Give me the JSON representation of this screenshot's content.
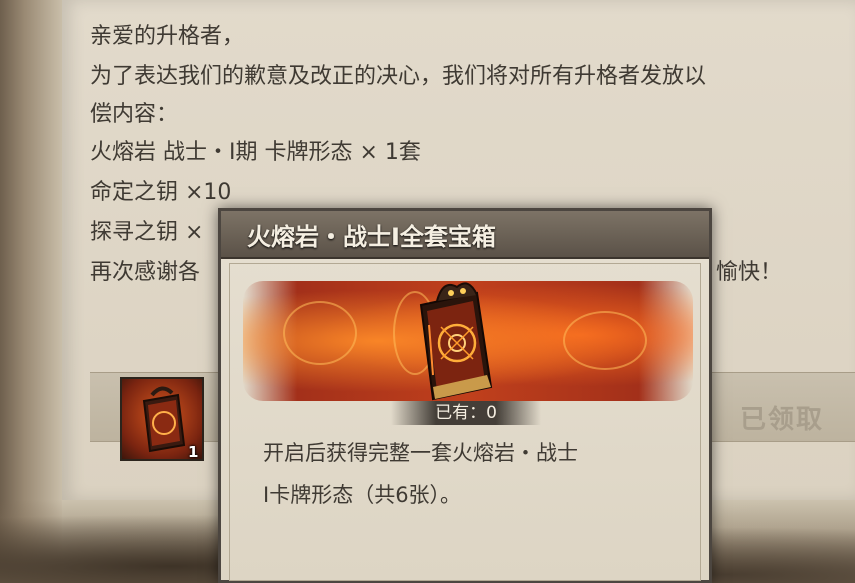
{
  "letter": {
    "lines": [
      "亲爱的升格者，",
      "为了表达我们的歉意及改正的决心，我们将对所有升格者发放以",
      "偿内容：",
      "火熔岩 战士・Ⅰ期 卡牌形态 × 1套",
      "命定之钥 ×10",
      "探寻之钥 ×",
      "再次感谢各",
      "愉快！"
    ]
  },
  "reward": {
    "count": "1",
    "claimed_label": "已领取"
  },
  "popup": {
    "title": "火熔岩・战士Ⅰ全套宝箱",
    "owned": "已有：0",
    "description_lines": [
      "开启后获得完整一套火熔岩・战士",
      "Ⅰ卡牌形态（共6张）。"
    ]
  },
  "colors": {
    "lava": "#c0401c",
    "header": "#5b5248",
    "text": "#3f3a33"
  },
  "icons": {
    "reward_item": "lava-chest-book-icon",
    "popup_item": "lava-chest-book-icon"
  }
}
